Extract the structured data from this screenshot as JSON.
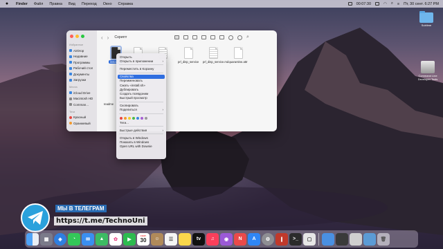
{
  "menubar": {
    "app": "Finder",
    "items": [
      "Файл",
      "Правка",
      "Вид",
      "Переход",
      "Окно",
      "Справка"
    ],
    "timer": "00:07:30",
    "clock": "Пт, 30 сент. 6:27 PM"
  },
  "desktop_icons": [
    {
      "label": "Sublime"
    },
    {
      "label": "Command Line Developer Tools"
    }
  ],
  "finder": {
    "title": "Скрипт",
    "sidebar": {
      "sections": [
        {
          "title": "Избранное",
          "items": [
            "AirDrop",
            "Недавние",
            "Программы",
            "Рабочий стол",
            "Документы",
            "Загрузки"
          ]
        },
        {
          "title": "Места",
          "items": [
            "iCloud Drive",
            "Macintosh HD",
            "Comman..."
          ]
        },
        {
          "title": "Теги",
          "items": [
            "Красный",
            "Оранжевый"
          ]
        }
      ]
    },
    "files": [
      {
        "name": "install.sh"
      },
      {
        "name": "prl_disp_service"
      },
      {
        "name": "prl_disp_service.md"
      },
      {
        "name": "quarantine.attr"
      },
      {
        "name": "readme"
      }
    ]
  },
  "context_menu": {
    "groups": [
      [
        "Открыть",
        "Открыть в приложении"
      ],
      [
        "Переместить в Корзину"
      ],
      [
        "Свойства",
        "Переименовать",
        "Сжать «install.sh»",
        "Дублировать",
        "Создать псевдоним",
        "Быстрый просмотр"
      ],
      [
        "Скопировать",
        "Поделиться"
      ],
      [
        "Теги..."
      ],
      [
        "Быстрые действия"
      ],
      [
        "Открыть в Windows",
        "Показать в Windows",
        "Open URL with Downie"
      ]
    ],
    "highlighted": "Свойства",
    "tag_colors": [
      "#e8463f",
      "#f39a2e",
      "#f3cf2e",
      "#4cb94a",
      "#3a86e0",
      "#a65fd3",
      "#9a9a9a"
    ]
  },
  "promo": {
    "line1": "МЫ В ТЕЛЕГРАМ",
    "line2": "https://t.me/TechnoUni"
  },
  "dock": {
    "calendar_month": "СЕНТ.",
    "calendar_day": "30"
  }
}
